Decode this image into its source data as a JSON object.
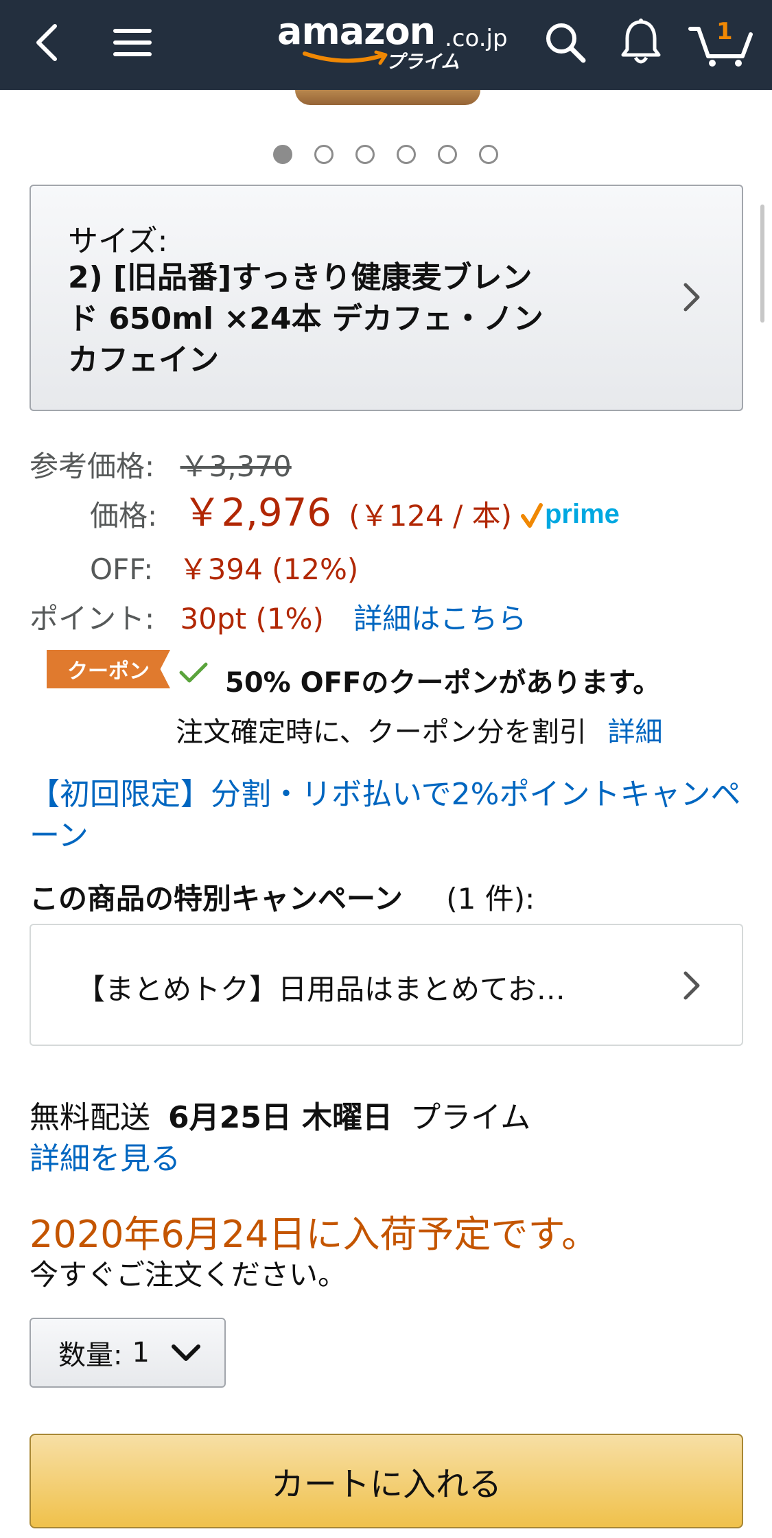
{
  "header": {
    "logo_word": "amazon",
    "logo_tld": ".co.jp",
    "logo_sub": "プライム",
    "cart_count": "1",
    "icons": [
      "back-icon",
      "menu-icon",
      "search-icon",
      "bell-icon",
      "cart-icon"
    ]
  },
  "carousel": {
    "dot_count": 6,
    "active_index": 0
  },
  "size": {
    "label": "サイズ:",
    "value": "2) [旧品番]すっきり健康麦ブレンド 650ml ×24本 デカフェ・ノンカフェイン"
  },
  "price": {
    "ref_label": "参考価格:",
    "ref_value": "￥3,370",
    "price_label": "価格:",
    "price_value": "￥2,976",
    "unit_price": "(￥124 / 本)",
    "prime_text": "prime",
    "off_label": "OFF:",
    "off_value": "￥394 (12%)",
    "point_label": "ポイント:",
    "point_value": "30pt  (1%)",
    "point_link": "詳細はこちら"
  },
  "coupon": {
    "tag": "クーポン",
    "text": "50% OFFのクーポンがあります。",
    "sub": "注文確定時に、クーポン分を割引",
    "sub_link": "詳細"
  },
  "campaign_link": "【初回限定】分割・リボ払いで2%ポイントキャンペーン",
  "special": {
    "heading": "この商品の特別キャンペーン",
    "count": "(1 件):",
    "item": "【まとめトク】日用品はまとめてお…"
  },
  "delivery": {
    "prefix": "無料配送",
    "date": "6月25日 木曜日",
    "suffix": "プライム",
    "link": "詳細を見る"
  },
  "stock": {
    "message": "2020年6月24日に入荷予定です。",
    "sub": "今すぐご注文ください。"
  },
  "quantity": {
    "label": "数量:",
    "value": "1"
  },
  "add_to_cart": "カートに入れる",
  "colors": {
    "header_bg": "#232f3e",
    "price_red": "#b12704",
    "link_blue": "#0066c0",
    "stock_orange": "#c45500",
    "coupon_orange": "#e07a2e",
    "cart_button": "#f0c14b"
  }
}
